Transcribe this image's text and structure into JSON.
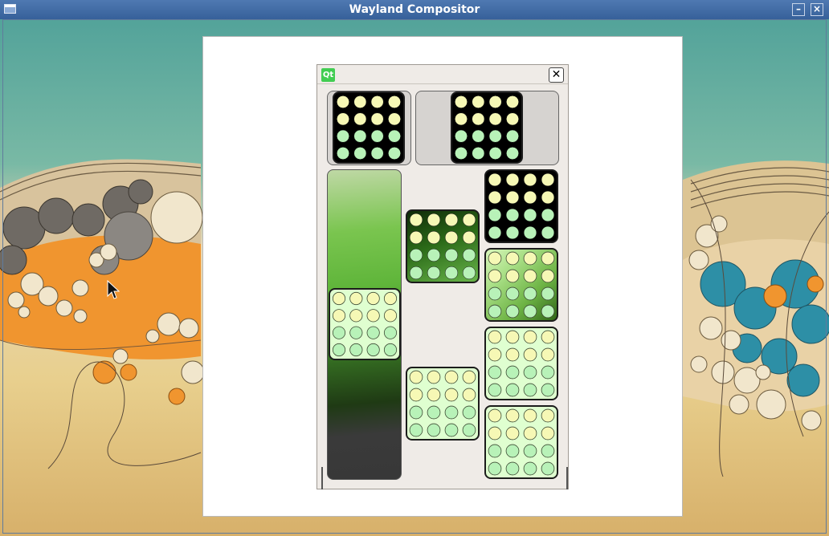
{
  "window": {
    "title": "Wayland Compositor",
    "minimize_glyph": "–",
    "close_glyph": "×"
  },
  "client": {
    "logo_text": "Qt",
    "close_glyph": "✕"
  },
  "icons": {
    "window_menu": "window-menu-icon",
    "minimize": "minimize-icon",
    "close": "close-icon",
    "qt_logo": "qt-logo-icon",
    "cursor": "mouse-pointer-icon",
    "tile_dots": "dot-grid-icon"
  },
  "colors": {
    "titlebar": "#4f79b2",
    "qt_green": "#41cd52",
    "dot_yellow": "#f6f8b5",
    "dot_green": "#b8f2b8",
    "tile_dark": "#000000",
    "tile_pale": "#dfffd0"
  }
}
